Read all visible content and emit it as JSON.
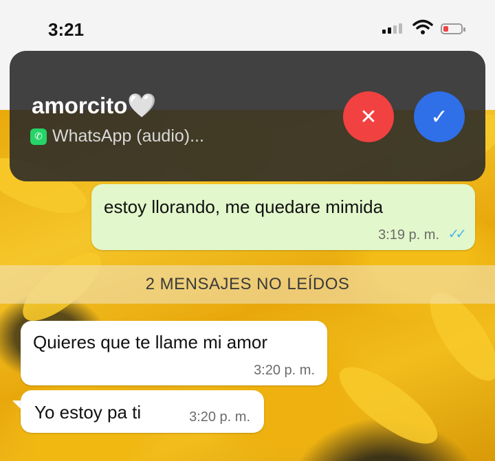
{
  "status_bar": {
    "time": "3:21"
  },
  "call": {
    "caller_name": "amorcito",
    "caller_emoji": "🤍",
    "subtitle": "WhatsApp (audio)...",
    "decline_icon": "✕",
    "accept_icon": "✓"
  },
  "messages": {
    "outgoing": [
      {
        "text": "estoy llorando, me quedare mimida",
        "time": "3:19 p. m.",
        "ticks": "✓✓"
      }
    ],
    "unread_separator": "2 MENSAJES NO LEÍDOS",
    "incoming": [
      {
        "text": "Quieres que te llame mi amor",
        "time": "3:20 p. m."
      },
      {
        "text": "Yo estoy pa ti",
        "time": "3:20 p. m."
      }
    ]
  },
  "colors": {
    "decline": "#f14141",
    "accept": "#2f6fe8",
    "outgoing_bubble": "#e2f7cb",
    "read_ticks": "#4fb6ec"
  },
  "icons": [
    "signal-icon",
    "wifi-icon",
    "battery-icon",
    "whatsapp-icon",
    "heart-icon",
    "decline-icon",
    "accept-icon",
    "read-ticks-icon"
  ]
}
